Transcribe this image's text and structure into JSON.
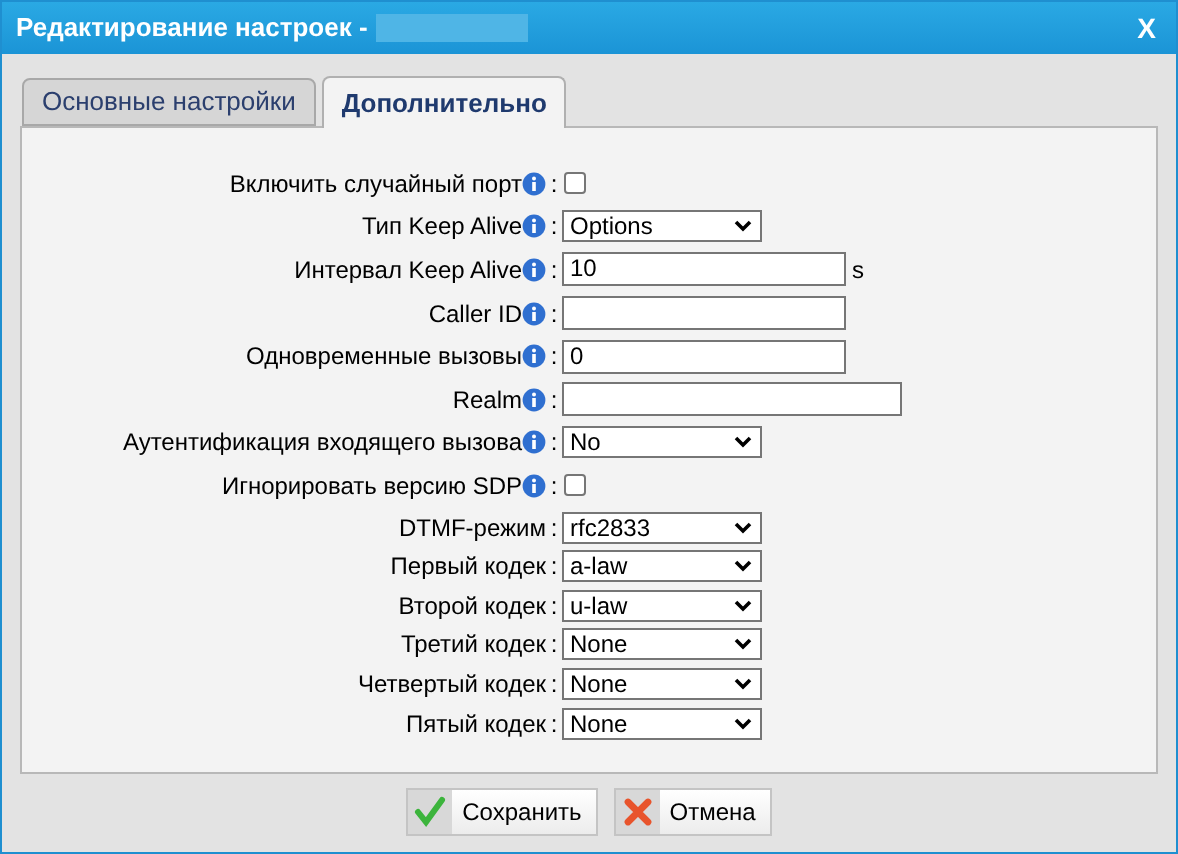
{
  "window": {
    "title": "Редактирование настроек -",
    "close": "X"
  },
  "tabs": [
    {
      "label": "Основные настройки",
      "selected": false
    },
    {
      "label": "Дополнительно",
      "selected": true
    }
  ],
  "fields": [
    {
      "kind": "checkbox",
      "label": "Включить случайный порт",
      "info": true,
      "checked": false
    },
    {
      "kind": "select",
      "label": "Тип Keep Alive",
      "info": true,
      "value": "Options"
    },
    {
      "kind": "text",
      "label": "Интервал Keep Alive",
      "info": true,
      "value": "10",
      "unit": "s"
    },
    {
      "kind": "text",
      "label": "Caller ID",
      "info": true
    },
    {
      "kind": "text",
      "label": "Одновременные вызовы",
      "info": true,
      "value": "0"
    },
    {
      "kind": "wide_text",
      "label": "Realm",
      "info": true
    },
    {
      "kind": "select",
      "label": "Аутентификация входящего вызова",
      "info": true,
      "value": "No"
    },
    {
      "kind": "checkbox",
      "label": "Игнорировать версию SDP",
      "info": true,
      "checked": false
    },
    {
      "kind": "select",
      "label": "DTMF-режим",
      "info": false,
      "value": "rfc2833"
    },
    {
      "kind": "select",
      "label": "Первый кодек",
      "info": false,
      "value": "a-law"
    },
    {
      "kind": "select",
      "label": "Второй кодек",
      "info": false,
      "value": "u-law"
    },
    {
      "kind": "select",
      "label": "Третий кодек",
      "info": false,
      "value": "None"
    },
    {
      "kind": "select",
      "label": "Четвертый кодек",
      "info": false,
      "value": "None"
    },
    {
      "kind": "select",
      "label": "Пятый кодек",
      "info": false,
      "value": "None"
    }
  ],
  "separator": ":",
  "buttons": [
    {
      "kind": "save",
      "label": "Сохранить"
    },
    {
      "kind": "cancel",
      "label": "Отмена"
    }
  ]
}
